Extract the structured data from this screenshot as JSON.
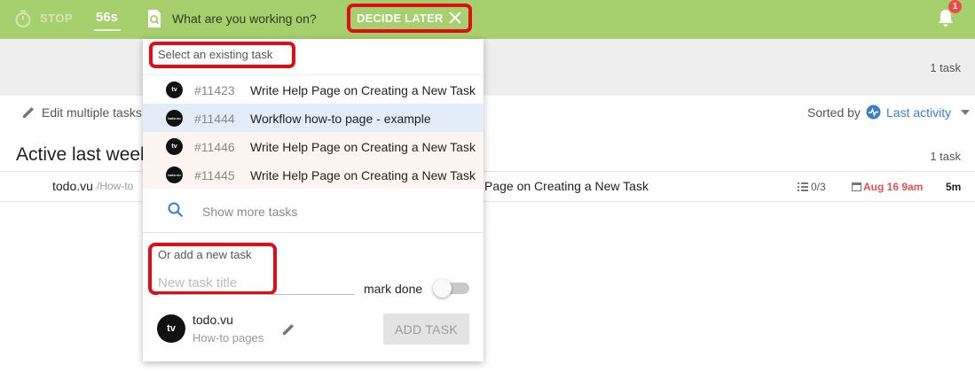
{
  "topbar": {
    "stop_label": "STOP",
    "timer": "56s",
    "prompt": "What are you working on?",
    "decide_later": "DECIDE LATER",
    "notification_count": "1"
  },
  "page": {
    "top_count": "1 task",
    "edit_multiple": "Edit multiple tasks",
    "sorted_by": "Sorted by",
    "sort_value": "Last activity",
    "section_title": "Active last week",
    "section_count": "1 task",
    "row": {
      "project": "todo.vu",
      "path": "/How-to",
      "title": "Page on Creating a New Task",
      "checklist": "0/3",
      "due": "Aug 16 9am",
      "time": "5m"
    }
  },
  "dropdown": {
    "select_heading": "Select an existing task",
    "tasks": [
      {
        "avatar": "tv",
        "id": "#11423",
        "title": "Write Help Page on Creating a New Task"
      },
      {
        "avatar": "todo.vu",
        "id": "#11444",
        "title": "Workflow how-to page - example"
      },
      {
        "avatar": "tv",
        "id": "#11446",
        "title": "Write Help Page on Creating a New Task"
      },
      {
        "avatar": "todo.vu",
        "id": "#11445",
        "title": "Write Help Page on Creating a New Task"
      }
    ],
    "show_more": "Show more tasks",
    "add_heading": "Or add a new task",
    "new_task_placeholder": "New task title",
    "new_task_value": "",
    "mark_done": "mark done",
    "mark_done_on": false,
    "project": {
      "avatar": "tv",
      "name": "todo.vu",
      "sub": "How-to pages"
    },
    "add_button": "ADD TASK"
  },
  "colors": {
    "topbar": "#a6cf6d",
    "highlight": "#e00d17",
    "link": "#3d7fc4",
    "selected_row": "#e3edf7",
    "hover_row": "#fdf5f2",
    "due": "#e45050"
  },
  "icons": [
    "stopwatch-icon",
    "document-search-icon",
    "close-icon",
    "bell-icon",
    "pencil-icon",
    "activity-icon",
    "caret-down-icon",
    "checklist-icon",
    "calendar-icon",
    "search-icon"
  ]
}
